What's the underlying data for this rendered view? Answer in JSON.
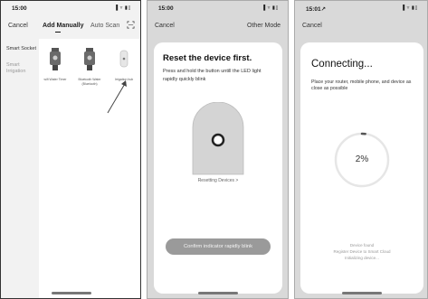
{
  "screen1": {
    "status": {
      "time": "15:00",
      "icons": "▐ ▿ ▮▯"
    },
    "nav": {
      "cancel": "Cancel"
    },
    "tabs": {
      "active": "Add Manually",
      "other": "Auto Scan"
    },
    "sidebar": [
      {
        "label": "Smart Socket"
      },
      {
        "label": "Smart Irrigation"
      }
    ],
    "devices": [
      {
        "label": "wifi Water Timer"
      },
      {
        "label": "Bluetooth Water (Bluetooth)"
      },
      {
        "label": "Irrigation hub"
      }
    ]
  },
  "screen2": {
    "status": {
      "time": "15:00",
      "icons": "▐ ▿ ▮▯"
    },
    "nav": {
      "cancel": "Cancel",
      "other_mode": "Other Mode"
    },
    "title": "Reset the device first.",
    "description": "Press and hold the button untill the LED light rapidly quickly blink",
    "reset_link": "Resetting Devices >",
    "confirm_button": "Confirm indicator rapidly blink"
  },
  "screen3": {
    "status": {
      "time": "15:01↗",
      "icons": "▐ ▿ ▮▯"
    },
    "nav": {
      "cancel": "Cancel"
    },
    "title": "Connecting...",
    "description": "Place your router, mobile phone, and device as close as possible",
    "progress": {
      "percent": 2,
      "label": "2%"
    },
    "steps": [
      "Device found",
      "Register Device to Smart Cloud",
      "Initializing device..."
    ]
  }
}
